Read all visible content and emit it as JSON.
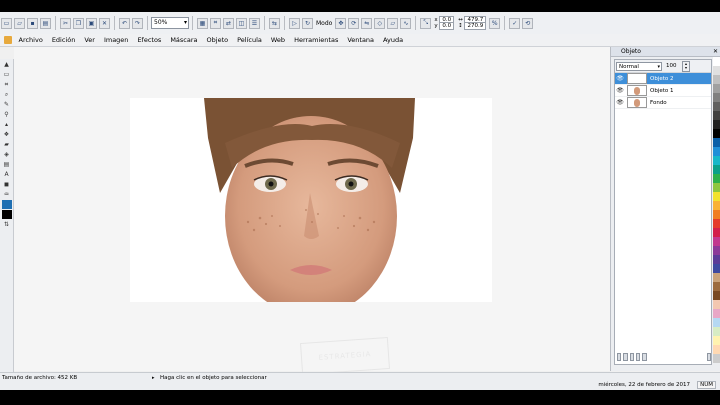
{
  "toolbar": {
    "zoom_value": "50%",
    "mode_label": "Modo",
    "coord_x": "0.0",
    "coord_y": "0.0",
    "coord_w": "479.7",
    "coord_h": "270.9"
  },
  "menu": {
    "items": [
      "Archivo",
      "Edición",
      "Ver",
      "Imagen",
      "Efectos",
      "Máscara",
      "Objeto",
      "Película",
      "Web",
      "Herramientas",
      "Ventana",
      "Ayuda"
    ]
  },
  "panel": {
    "title": "Objeto",
    "blend_mode": "Normal",
    "opacity": "100",
    "layers": [
      {
        "name": "Objeto 2",
        "selected": true
      },
      {
        "name": "Objeto 1",
        "selected": false
      },
      {
        "name": "Fondo",
        "selected": false
      }
    ]
  },
  "canvas": {
    "watermark_text": "ESTRATEGIA"
  },
  "status": {
    "file_size": "Tamaño de archivo: 452 KB",
    "hint": "Haga clic en el objeto para seleccionar",
    "date": "miércoles, 22 de febrero de 2017",
    "num": "NUM"
  },
  "palette_colors": [
    "#ffffff",
    "#e0e0e0",
    "#c0c0c0",
    "#a0a0a0",
    "#808080",
    "#606060",
    "#404040",
    "#202020",
    "#000000",
    "#0a5fa8",
    "#1f8fd8",
    "#17b7c9",
    "#0aa08a",
    "#2db04b",
    "#8ec63f",
    "#f2e22e",
    "#f9b233",
    "#f07d22",
    "#e53b2b",
    "#d31f4a",
    "#c2398f",
    "#8c3a99",
    "#5b3c98",
    "#3e4aa0",
    "#c9a27a",
    "#9c6b3f",
    "#7a4a24",
    "#f3c7b0",
    "#e8a7c6",
    "#b5d8f2",
    "#d7ecc4",
    "#fff3b0",
    "#ffd9b3",
    "#cccccc"
  ]
}
